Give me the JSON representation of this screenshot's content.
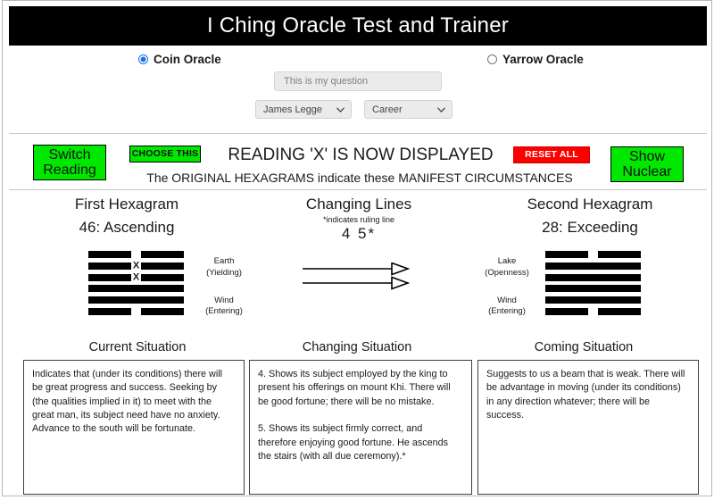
{
  "header": {
    "title": "I Ching Oracle Test and Trainer"
  },
  "oracle_mode": {
    "coin_label": "Coin Oracle",
    "coin_selected": true,
    "yarrow_label": "Yarrow Oracle",
    "yarrow_selected": false
  },
  "question": {
    "value": "",
    "placeholder": "This is my question"
  },
  "selects": {
    "translator": "James Legge",
    "topic": "Career"
  },
  "toolbar": {
    "switch_reading": "Switch\nReading",
    "choose_this": "CHOOSE THIS",
    "reset_all": "RESET ALL",
    "show_nuclear": "Show\nNuclear",
    "headline": "READING 'X' IS NOW DISPLAYED",
    "subline": "The ORIGINAL HEXAGRAMS indicate these MANIFEST CIRCUMSTANCES",
    "green": "#00E800",
    "red": "#FC0000"
  },
  "first_hexagram": {
    "heading": "First Hexagram",
    "name": "46:  Ascending",
    "number": 46,
    "lines": [
      {
        "type": "yin",
        "mark": ""
      },
      {
        "type": "yin",
        "mark": "X"
      },
      {
        "type": "yin",
        "mark": "X"
      },
      {
        "type": "yang",
        "mark": ""
      },
      {
        "type": "yang",
        "mark": ""
      },
      {
        "type": "yin",
        "mark": ""
      }
    ],
    "upper_trigram": "Earth",
    "upper_trigram_attr": "(Yielding)",
    "lower_trigram": "Wind",
    "lower_trigram_attr": "(Entering)"
  },
  "changing": {
    "heading": "Changing Lines",
    "note": "*indicates ruling line",
    "numbers": "4  5*",
    "lines": [
      4,
      5
    ],
    "ruling_line": 5,
    "arrow_count": 2
  },
  "second_hexagram": {
    "heading": "Second Hexagram",
    "name": "28:  Exceeding",
    "number": 28,
    "lines": [
      {
        "type": "yin",
        "mark": ""
      },
      {
        "type": "yang",
        "mark": ""
      },
      {
        "type": "yang",
        "mark": ""
      },
      {
        "type": "yang",
        "mark": ""
      },
      {
        "type": "yang",
        "mark": ""
      },
      {
        "type": "yin",
        "mark": ""
      }
    ],
    "upper_trigram": "Lake",
    "upper_trigram_attr": "(Openness)",
    "lower_trigram": "Wind",
    "lower_trigram_attr": "(Entering)"
  },
  "situations": {
    "current_label": "Current Situation",
    "changing_label": "Changing Situation",
    "coming_label": "Coming Situation",
    "current_text": "Indicates that (under its conditions) there will be great progress and success. Seeking by (the qualities implied in it) to meet with the great man, its subject need have no anxiety. Advance to the south will be fortunate.",
    "changing_text": "4. Shows its subject employed by the king to present his offerings on mount Khi. There will be good fortune; there will be no mistake.\n\n5. Shows its subject firmly correct, and therefore enjoying good fortune. He ascends the stairs (with all due ceremony).*",
    "coming_text": "Suggests to us a beam that is weak. There will be advantage in moving (under its conditions) in any direction whatever; there will be success."
  }
}
